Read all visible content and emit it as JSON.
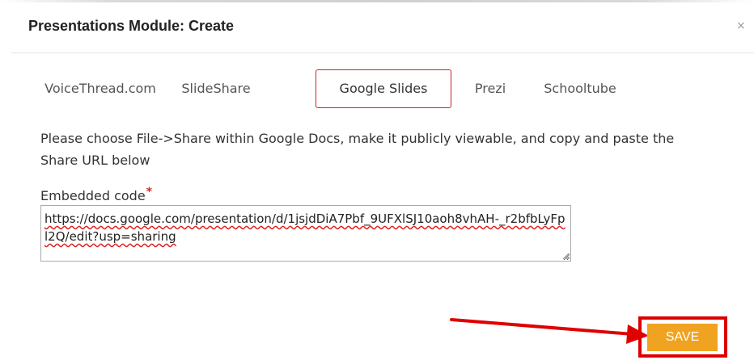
{
  "modal": {
    "title": "Presentations Module: Create",
    "close_glyph": "×"
  },
  "tabs": [
    {
      "label": "VoiceThread.com",
      "active": false
    },
    {
      "label": "SlideShare",
      "active": false
    },
    {
      "label": "Google Slides",
      "active": true
    },
    {
      "label": "Prezi",
      "active": false
    },
    {
      "label": "Schooltube",
      "active": false
    }
  ],
  "instructions": "Please choose File->Share within Google Docs, make it publicly viewable, and copy and paste the Share URL below",
  "embed_field": {
    "label": "Embedded code",
    "required_marker": "*",
    "value": "https://docs.google.com/presentation/d/1jsjdDiA7Pbf_9UFXlSJ10aoh8vhAH-_r2bfbLyFpl2Q/edit?usp=sharing"
  },
  "save_button": {
    "label": "SAVE"
  },
  "colors": {
    "accent_orange": "#f0a320",
    "highlight_red": "#dd0000",
    "active_tab_border": "#cc2222"
  }
}
